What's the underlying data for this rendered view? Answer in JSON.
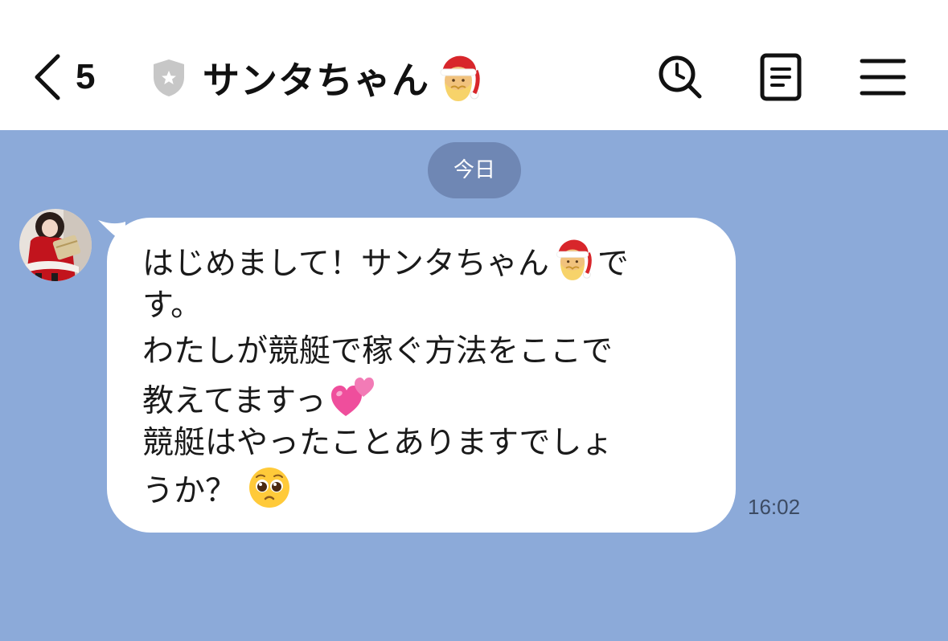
{
  "header": {
    "back_count": "5",
    "title": "サンタちゃん",
    "title_emoji": "santa-face",
    "shield_color": "#c7c7c7"
  },
  "chat": {
    "background": "#8caad9",
    "date_label": "今日",
    "message": {
      "lines": [
        "はじめまして！サンタちゃん",
        "す。",
        "わたしが競艇で稼ぐ方法をここで",
        "教えてますっ",
        "競艇はやったことありますでしょ",
        "うか？"
      ],
      "line1_suffix": "で",
      "emojis": [
        "santa-face",
        "two-hearts",
        "pleading-face"
      ],
      "time": "16:02"
    }
  }
}
